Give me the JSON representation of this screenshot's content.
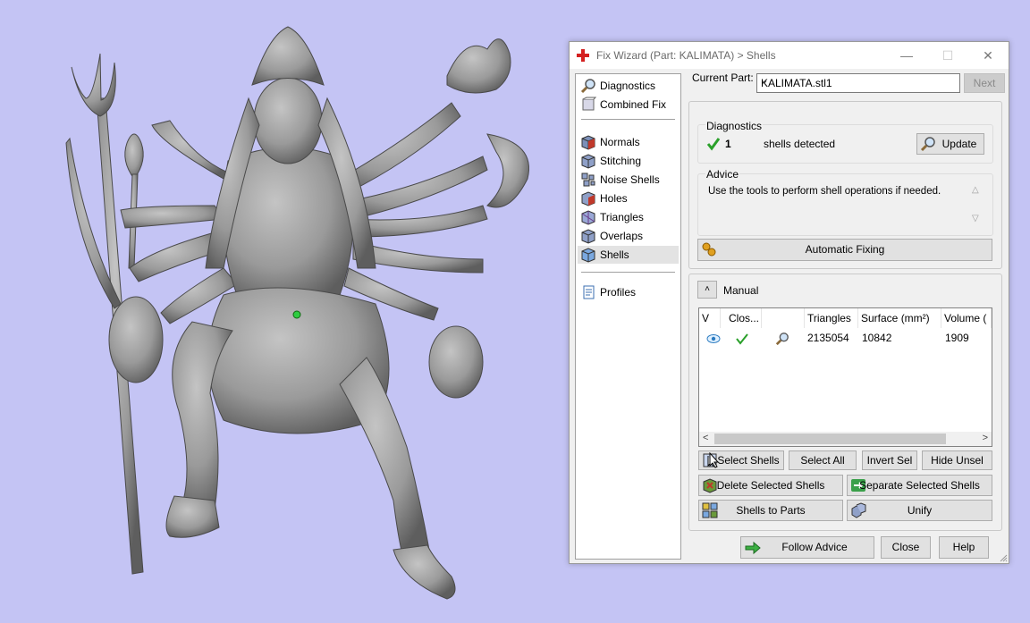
{
  "window": {
    "title": "Fix Wizard (Part: KALIMATA) > Shells",
    "minimize_label": "—",
    "maximize_label": "☐",
    "close_label": "✕"
  },
  "nav": {
    "items": [
      {
        "label": "Diagnostics",
        "icon": "magnifier-icon"
      },
      {
        "label": "Combined Fix",
        "icon": "combined-fix-icon"
      },
      {
        "label": "Normals",
        "icon": "normals-cube-icon"
      },
      {
        "label": "Stitching",
        "icon": "stitching-cube-icon"
      },
      {
        "label": "Noise Shells",
        "icon": "noise-shells-icon"
      },
      {
        "label": "Holes",
        "icon": "holes-cube-icon"
      },
      {
        "label": "Triangles",
        "icon": "triangles-cube-icon"
      },
      {
        "label": "Overlaps",
        "icon": "overlaps-cube-icon"
      },
      {
        "label": "Shells",
        "icon": "shells-cube-icon"
      },
      {
        "label": "Profiles",
        "icon": "profiles-document-icon"
      }
    ],
    "selected": "Shells"
  },
  "current_part": {
    "label": "Current Part:",
    "value": "KALIMATA.stl1",
    "next_label": "Next"
  },
  "diagnostics": {
    "title": "Diagnostics",
    "count": "1",
    "text": "shells detected",
    "update_label": "Update"
  },
  "advice": {
    "title": "Advice",
    "text": "Use the tools to perform shell operations if needed.",
    "automatic_fixing_label": "Automatic Fixing"
  },
  "manual": {
    "title": "Manual",
    "columns": [
      "V",
      "Clos...",
      "",
      "Triangles",
      "Surface (mm²)",
      "Volume ("
    ],
    "rows": [
      {
        "triangles": "2135054",
        "surface": "10842",
        "volume": "1909"
      }
    ],
    "scroll_left": "<",
    "scroll_right": ">"
  },
  "buttons": {
    "select_shells": "Select Shells",
    "select_all": "Select All",
    "invert_sel": "Invert Sel",
    "hide_unsel": "Hide Unsel",
    "delete_selected": "Delete Selected Shells",
    "separate_selected": "Separate Selected Shells",
    "shells_to_parts": "Shells to Parts",
    "unify": "Unify",
    "follow_advice": "Follow Advice",
    "close": "Close",
    "help": "Help"
  },
  "colors": {
    "background": "#c4c4f4",
    "model_gray": "#9a9a9a",
    "check_green": "#2aa02a",
    "arrow_green": "#3cb043"
  }
}
